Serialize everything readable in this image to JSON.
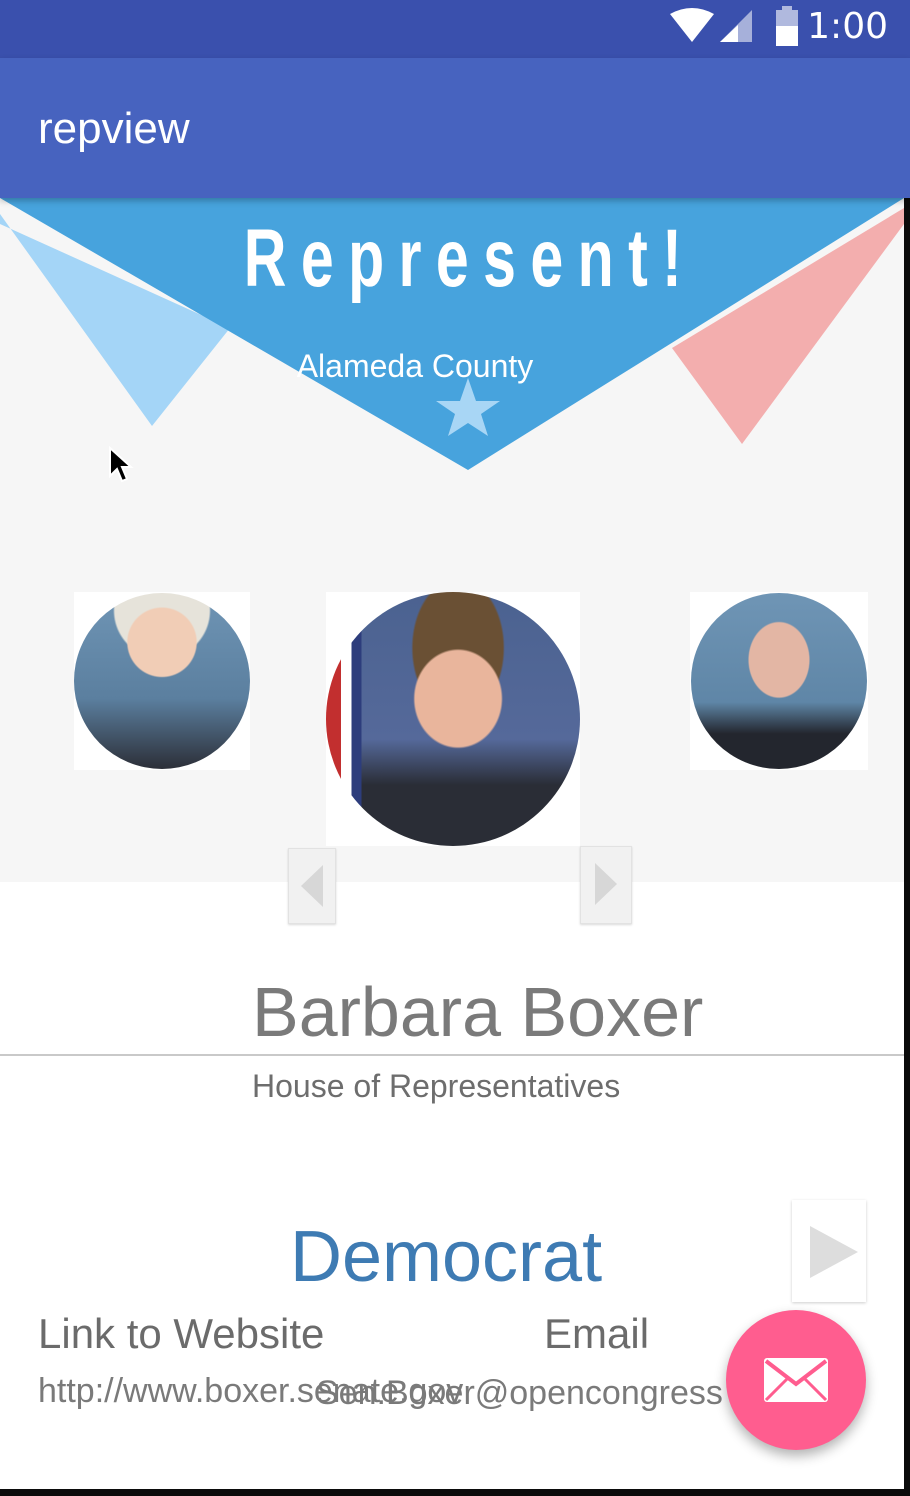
{
  "status_bar": {
    "time": "1:00",
    "icons": [
      "wifi-icon",
      "signal-icon",
      "battery-icon"
    ]
  },
  "app_bar": {
    "title": "repview",
    "color": "#4763bf"
  },
  "banner": {
    "title": "Represent!",
    "county": "Alameda County",
    "colors": {
      "main": "#47a3dd",
      "left_flag": "#a4d5f7",
      "right_flag": "#f3aeae",
      "star": "#a8d6f5"
    }
  },
  "carousel": {
    "portraits": [
      {
        "name": "portrait-left"
      },
      {
        "name": "portrait-center"
      },
      {
        "name": "portrait-right"
      }
    ]
  },
  "representative": {
    "name": "Barbara Boxer",
    "chamber": "House of Representatives",
    "party": "Democrat",
    "party_color": "#3e7bb3",
    "website_label": "Link to Website",
    "website_url": "http://www.boxer.senate.gov",
    "email_label": "Email",
    "email": "Sen.Boxer@opencongress"
  },
  "fab": {
    "icon": "mail-icon",
    "color": "#ff5d8f"
  }
}
